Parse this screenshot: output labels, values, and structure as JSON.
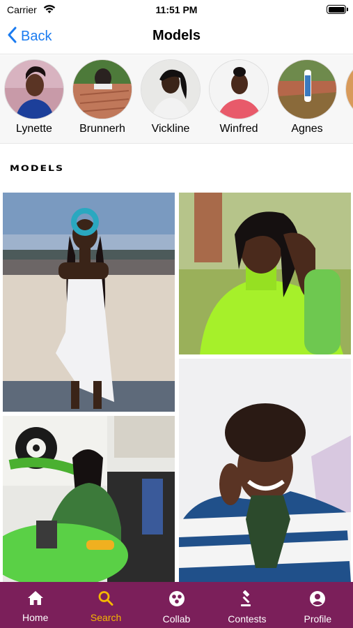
{
  "status": {
    "carrier": "Carrier",
    "time": "11:51 PM"
  },
  "nav": {
    "back_label": "Back",
    "title": "Models"
  },
  "stories": [
    {
      "name": "Lynette"
    },
    {
      "name": "Brunnerh"
    },
    {
      "name": "Vickline"
    },
    {
      "name": "Winfred"
    },
    {
      "name": "Agnes"
    }
  ],
  "section": {
    "title": "Models"
  },
  "tabs": [
    {
      "label": "Home",
      "icon": "home-icon"
    },
    {
      "label": "Search",
      "icon": "search-icon",
      "active": true
    },
    {
      "label": "Collab",
      "icon": "collab-icon"
    },
    {
      "label": "Contests",
      "icon": "gavel-icon"
    },
    {
      "label": "Profile",
      "icon": "profile-icon"
    }
  ],
  "colors": {
    "accent": "#1a7bf0",
    "tab_bar": "#7b1f5a",
    "tab_active": "#f5b800"
  }
}
